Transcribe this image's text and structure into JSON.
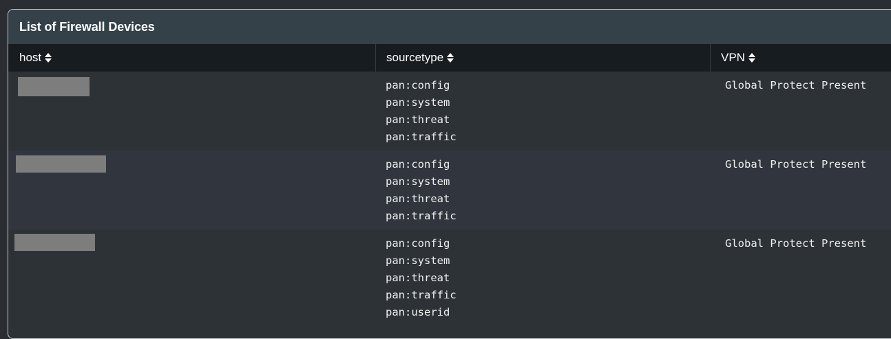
{
  "panel": {
    "title": "List of Firewall Devices"
  },
  "table": {
    "columns": [
      {
        "label": "host",
        "sort_icon": "sort-icon"
      },
      {
        "label": "sourcetype",
        "sort_icon": "sort-icon"
      },
      {
        "label": "VPN",
        "sort_icon": "sort-icon"
      }
    ],
    "rows": [
      {
        "host": "",
        "sourcetypes": [
          "pan:config",
          "pan:system",
          "pan:threat",
          "pan:traffic"
        ],
        "vpn": "Global Protect Present"
      },
      {
        "host": "",
        "sourcetypes": [
          "pan:config",
          "pan:system",
          "pan:threat",
          "pan:traffic"
        ],
        "vpn": "Global Protect Present"
      },
      {
        "host": "",
        "sourcetypes": [
          "pan:config",
          "pan:system",
          "pan:threat",
          "pan:traffic",
          "pan:userid"
        ],
        "vpn": "Global Protect Present"
      }
    ]
  },
  "colors": {
    "background": "#2a2e33",
    "header": "#354149",
    "table_header": "#171c20",
    "redaction": "#7d7d7d"
  }
}
